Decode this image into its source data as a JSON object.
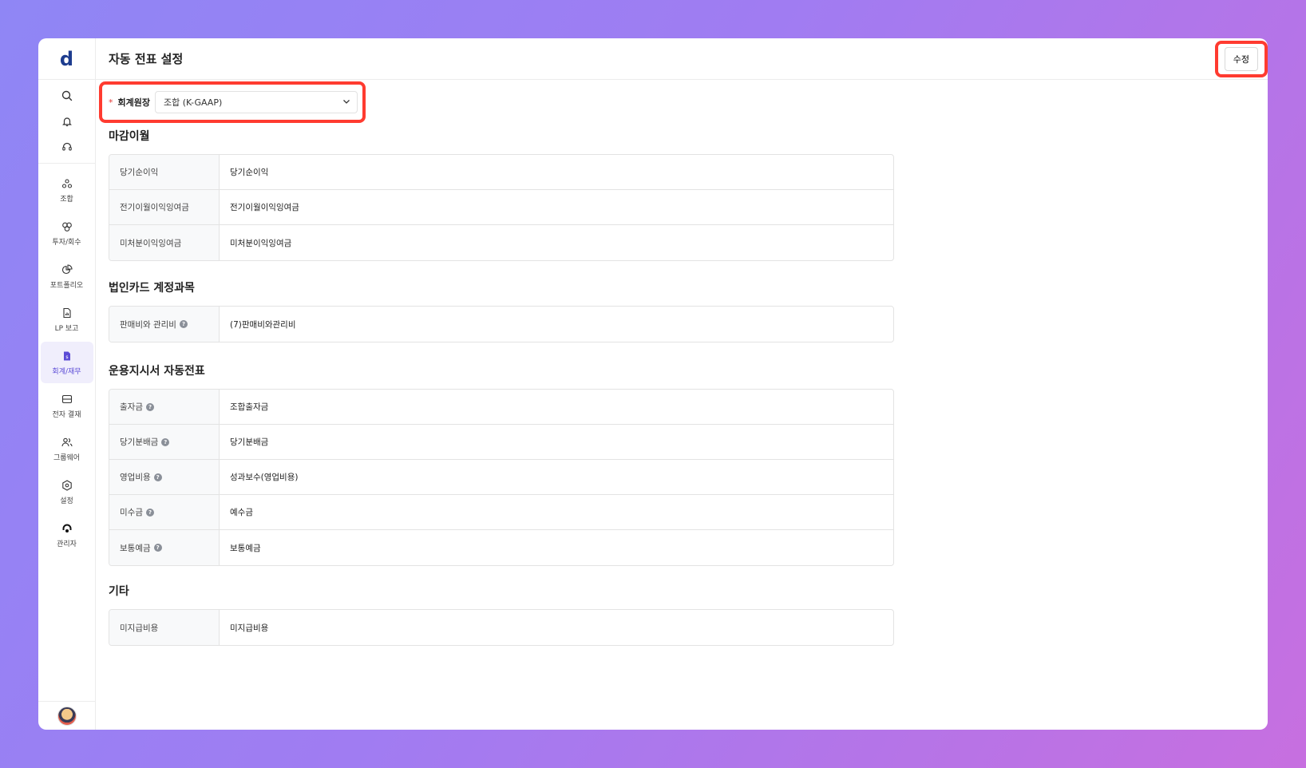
{
  "sidebar": {
    "logo": "d",
    "quick": [
      {
        "icon": "search-icon"
      },
      {
        "icon": "bell-icon"
      },
      {
        "icon": "headset-icon"
      }
    ],
    "items": [
      {
        "label": "조합",
        "icon": "association-icon",
        "active": false
      },
      {
        "label": "투자/회수",
        "icon": "investment-icon",
        "active": false
      },
      {
        "label": "포트폴리오",
        "icon": "pie-chart-icon",
        "active": false
      },
      {
        "label": "LP 보고",
        "icon": "report-icon",
        "active": false
      },
      {
        "label": "회계/재무",
        "icon": "accounting-icon",
        "active": true
      },
      {
        "label": "전자 결재",
        "icon": "approval-icon",
        "active": false
      },
      {
        "label": "그룹웨어",
        "icon": "groupware-icon",
        "active": false
      },
      {
        "label": "설정",
        "icon": "settings-icon",
        "active": false
      },
      {
        "label": "관리자",
        "icon": "admin-icon",
        "active": false
      }
    ]
  },
  "header": {
    "title": "자동 전표 설정",
    "edit_label": "수정"
  },
  "ledger": {
    "required_mark": "*",
    "label": "회계원장",
    "value": "조합 (K-GAAP)"
  },
  "sections": [
    {
      "title": "마감이월",
      "rows": [
        {
          "key": "당기순이익",
          "value": "당기순이익",
          "help": false
        },
        {
          "key": "전기이월이익잉여금",
          "value": "전기이월이익잉여금",
          "help": false
        },
        {
          "key": "미처분이익잉여금",
          "value": "미처분이익잉여금",
          "help": false
        }
      ]
    },
    {
      "title": "법인카드 계정과목",
      "rows": [
        {
          "key": "판매비와 관리비",
          "value": "(7)판매비와관리비",
          "help": true
        }
      ]
    },
    {
      "title": "운용지시서 자동전표",
      "rows": [
        {
          "key": "출자금",
          "value": "조합출자금",
          "help": true
        },
        {
          "key": "당기분배금",
          "value": "당기분배금",
          "help": true
        },
        {
          "key": "영업비용",
          "value": "성과보수(영업비용)",
          "help": true
        },
        {
          "key": "미수금",
          "value": "예수금",
          "help": true
        },
        {
          "key": "보통예금",
          "value": "보통예금",
          "help": true
        }
      ]
    },
    {
      "title": "기타",
      "rows": [
        {
          "key": "미지급비용",
          "value": "미지급비용",
          "help": false
        }
      ]
    }
  ],
  "colors": {
    "accent": "#5b4bd6",
    "highlight": "#ff3b30",
    "logo": "#1e3d8f"
  }
}
